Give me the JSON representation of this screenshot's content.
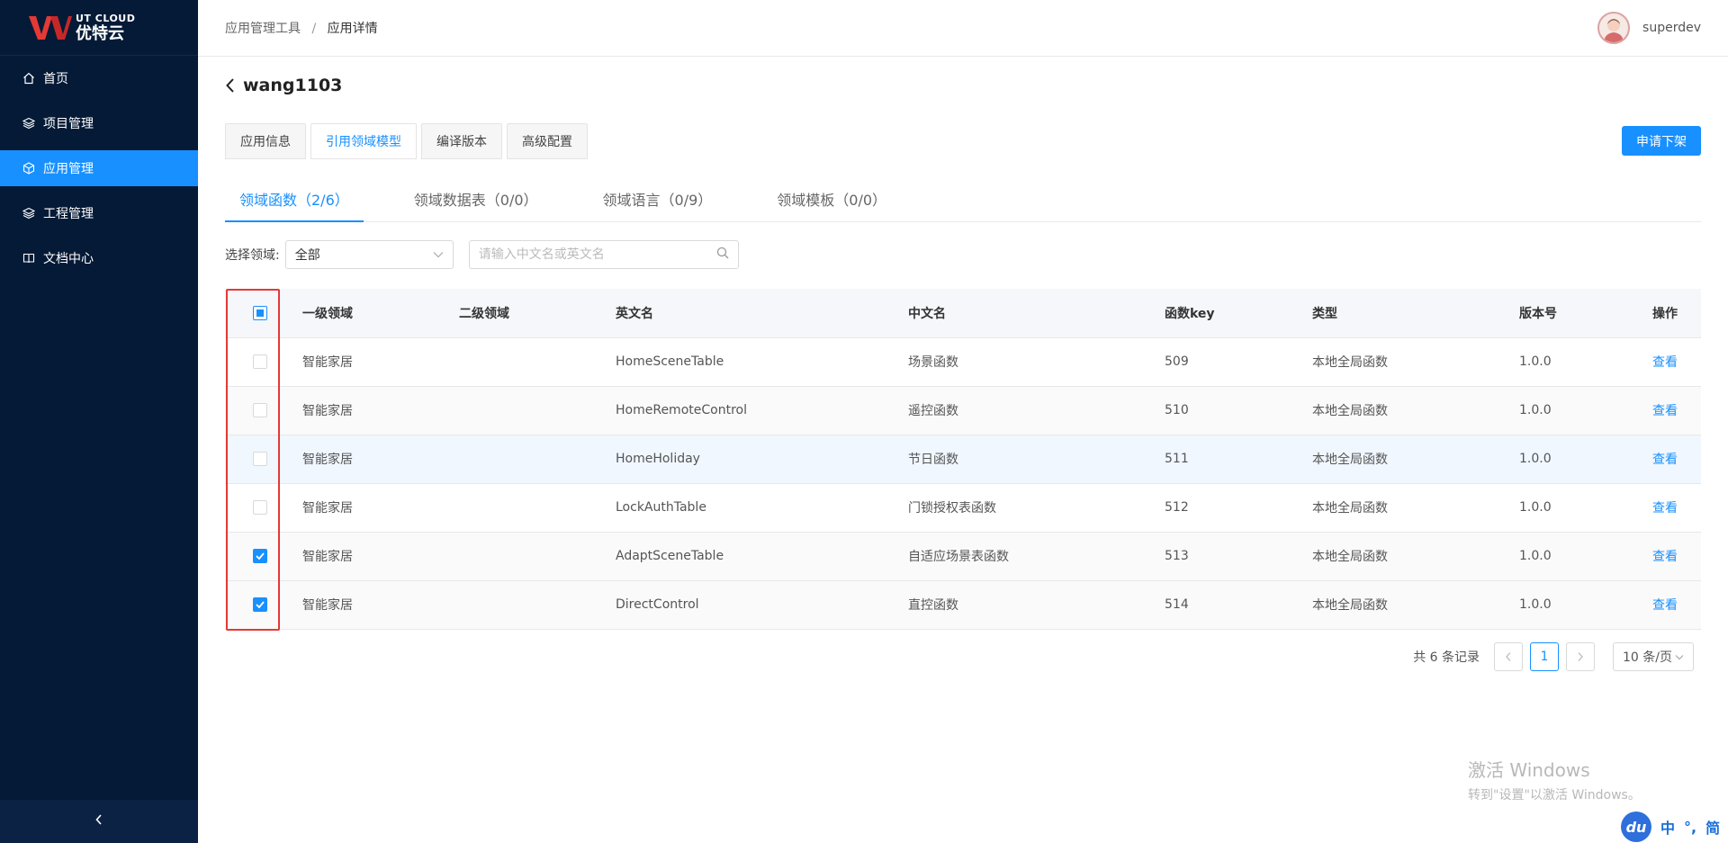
{
  "brand": {
    "en": "UT CLOUD",
    "cn": "优特云"
  },
  "sidebar": {
    "items": [
      {
        "label": "首页",
        "icon": "home-icon",
        "active": false
      },
      {
        "label": "项目管理",
        "icon": "layers-icon",
        "active": false
      },
      {
        "label": "应用管理",
        "icon": "cube-icon",
        "active": true
      },
      {
        "label": "工程管理",
        "icon": "layers-icon",
        "active": false
      },
      {
        "label": "文档中心",
        "icon": "book-icon",
        "active": false
      }
    ],
    "collapse_icon": "chevron-left-icon"
  },
  "header": {
    "breadcrumb": [
      "应用管理工具",
      "应用详情"
    ],
    "separator": "/",
    "username": "superdev"
  },
  "page": {
    "title": "wang1103",
    "tabs": [
      {
        "label": "应用信息",
        "active": false
      },
      {
        "label": "引用领域模型",
        "active": true
      },
      {
        "label": "编译版本",
        "active": false
      },
      {
        "label": "高级配置",
        "active": false
      }
    ],
    "action_button": "申请下架",
    "subtabs": [
      {
        "label": "领域函数（2/6）",
        "active": true
      },
      {
        "label": "领域数据表（0/0）",
        "active": false
      },
      {
        "label": "领域语言（0/9）",
        "active": false
      },
      {
        "label": "领域模板（0/0）",
        "active": false
      }
    ]
  },
  "filter": {
    "label": "选择领域:",
    "select_value": "全部",
    "search_placeholder": "请输入中文名或英文名"
  },
  "table": {
    "columns": [
      "一级领域",
      "二级领域",
      "英文名",
      "中文名",
      "函数key",
      "类型",
      "版本号",
      "操作"
    ],
    "header_checkbox": "indeterminate",
    "rows": [
      {
        "checked": false,
        "domain1": "智能家居",
        "domain2": "",
        "en": "HomeSceneTable",
        "cn": "场景函数",
        "key": "509",
        "type": "本地全局函数",
        "version": "1.0.0",
        "action": "查看"
      },
      {
        "checked": false,
        "domain1": "智能家居",
        "domain2": "",
        "en": "HomeRemoteControl",
        "cn": "遥控函数",
        "key": "510",
        "type": "本地全局函数",
        "version": "1.0.0",
        "action": "查看"
      },
      {
        "checked": false,
        "domain1": "智能家居",
        "domain2": "",
        "en": "HomeHoliday",
        "cn": "节日函数",
        "key": "511",
        "type": "本地全局函数",
        "version": "1.0.0",
        "action": "查看"
      },
      {
        "checked": false,
        "domain1": "智能家居",
        "domain2": "",
        "en": "LockAuthTable",
        "cn": "门锁授权表函数",
        "key": "512",
        "type": "本地全局函数",
        "version": "1.0.0",
        "action": "查看"
      },
      {
        "checked": true,
        "domain1": "智能家居",
        "domain2": "",
        "en": "AdaptSceneTable",
        "cn": "自适应场景表函数",
        "key": "513",
        "type": "本地全局函数",
        "version": "1.0.0",
        "action": "查看"
      },
      {
        "checked": true,
        "domain1": "智能家居",
        "domain2": "",
        "en": "DirectControl",
        "cn": "直控函数",
        "key": "514",
        "type": "本地全局函数",
        "version": "1.0.0",
        "action": "查看"
      }
    ]
  },
  "pagination": {
    "total_text": "共 6 条记录",
    "current_page": "1",
    "page_size": "10 条/页"
  },
  "watermark": {
    "title": "激活 Windows",
    "subtitle": "转到\"设置\"以激活 Windows。"
  },
  "ime": {
    "logo": "du",
    "items": [
      "中",
      "°,",
      "简"
    ]
  },
  "colors": {
    "sidebar_bg": "#051a36",
    "accent": "#1890ff",
    "highlight_box": "#e53935"
  }
}
